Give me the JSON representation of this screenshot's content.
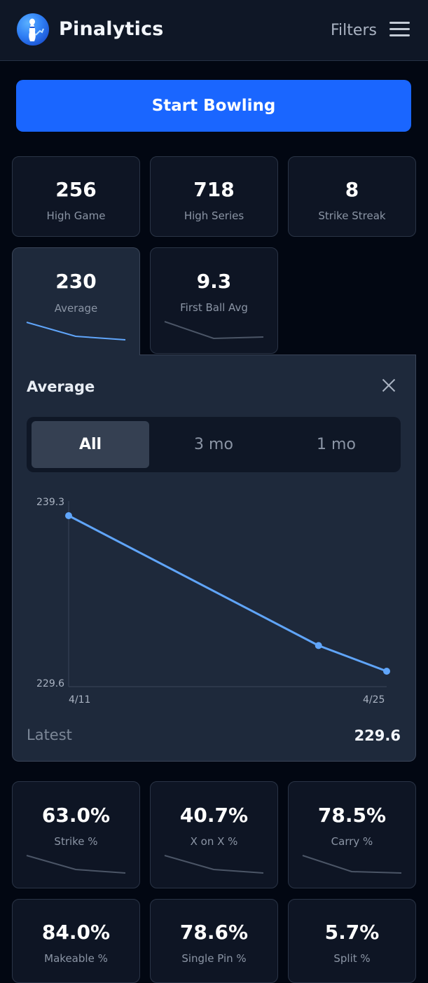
{
  "header": {
    "app_name": "Pinalytics",
    "logo_icon": "bowling-pin-logo-icon",
    "filters_label": "Filters",
    "menu_icon": "hamburger-menu-icon"
  },
  "start_button": {
    "label": "Start Bowling"
  },
  "stats": [
    {
      "value": "256",
      "label": "High Game"
    },
    {
      "value": "718",
      "label": "High Series"
    },
    {
      "value": "8",
      "label": "Strike Streak"
    },
    {
      "value": "230",
      "label": "Average",
      "selected": true
    },
    {
      "value": "9.3",
      "label": "First Ball Avg"
    }
  ],
  "detail": {
    "title": "Average",
    "close_icon": "close-icon",
    "ranges": [
      "All",
      "3 mo",
      "1 mo"
    ],
    "selected_range": "All",
    "latest_label": "Latest",
    "latest_value": "229.6"
  },
  "chart_data": {
    "type": "line",
    "x": [
      "4/11",
      "4/22",
      "4/25"
    ],
    "series": [
      {
        "values": [
          239.3,
          231.2,
          229.6
        ]
      }
    ],
    "ylim": [
      229.6,
      239.3
    ],
    "y_tick_labels": [
      "239.3",
      "229.6"
    ],
    "x_tick_labels": [
      "4/11",
      "4/25"
    ],
    "grid": false,
    "color": "#60a5fa"
  },
  "pct_stats": [
    {
      "value": "63.0%",
      "label": "Strike %"
    },
    {
      "value": "40.7%",
      "label": "X on X %"
    },
    {
      "value": "78.5%",
      "label": "Carry %"
    },
    {
      "value": "84.0%",
      "label": "Makeable %"
    },
    {
      "value": "78.6%",
      "label": "Single Pin %"
    },
    {
      "value": "5.7%",
      "label": "Split %"
    }
  ],
  "colors": {
    "accent": "#1a66ff",
    "line": "#60a5fa",
    "background": "#020712",
    "card": "#0e1524",
    "panel": "#1e293b"
  }
}
